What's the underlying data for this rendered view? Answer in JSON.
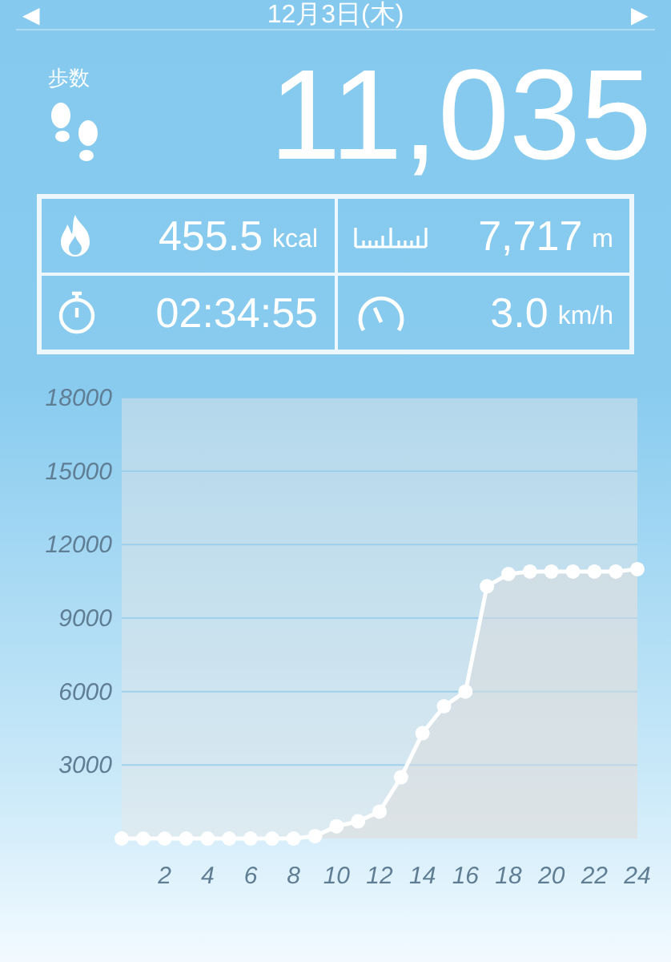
{
  "header": {
    "date": "12月3日(木)",
    "prev": "◀",
    "next": "▶"
  },
  "steps": {
    "label": "歩数",
    "value": "11,035"
  },
  "stats": [
    {
      "kind": "calories",
      "value": "455.5",
      "unit": "kcal"
    },
    {
      "kind": "distance",
      "value": "7,717",
      "unit": "m"
    },
    {
      "kind": "time",
      "value": "02:34:55"
    },
    {
      "kind": "speed",
      "value": "3.0",
      "unit": "km/h"
    }
  ],
  "chart_data": {
    "type": "area",
    "x": [
      0,
      1,
      2,
      3,
      4,
      5,
      6,
      7,
      8,
      9,
      10,
      11,
      12,
      13,
      14,
      15,
      16,
      17,
      18,
      19,
      20,
      21,
      22,
      23,
      24
    ],
    "series": [
      {
        "color": "#ffffff",
        "values": [
          0,
          0,
          0,
          0,
          0,
          0,
          0,
          0,
          0,
          100,
          500,
          700,
          1100,
          2500,
          4300,
          5400,
          6000,
          10300,
          10800,
          10900,
          10900,
          10900,
          10900,
          10900,
          11000
        ]
      }
    ],
    "grid": true,
    "xlim": [
      0,
      24
    ],
    "ylim": [
      0,
      18000
    ],
    "xticks": [
      2,
      4,
      6,
      8,
      10,
      12,
      14,
      16,
      18,
      20,
      22,
      24
    ],
    "yticks": [
      3000,
      6000,
      9000,
      12000,
      15000,
      18000
    ]
  }
}
